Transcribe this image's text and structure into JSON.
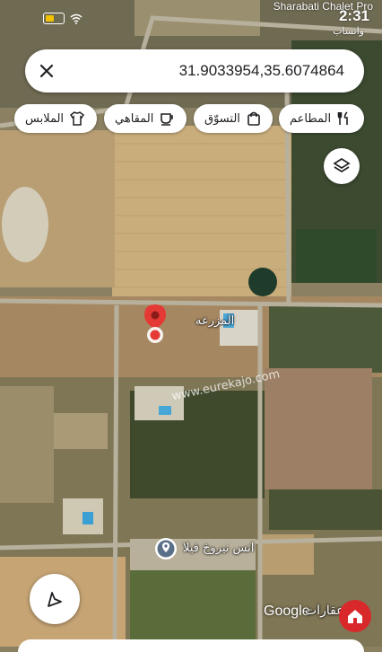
{
  "status_bar": {
    "place": "Sharabati Chalet Pro",
    "time": "2:31",
    "sub": "واتساب"
  },
  "search": {
    "query": "31.9033954,35.6074864"
  },
  "chips": [
    {
      "label": "المطاعم",
      "icon": "restaurant-icon"
    },
    {
      "label": "التسوّق",
      "icon": "shopping-bag-icon"
    },
    {
      "label": "المقاهي",
      "icon": "cafe-icon"
    },
    {
      "label": "الملابس",
      "icon": "shirt-icon"
    }
  ],
  "map": {
    "pin_label": "المزرعه",
    "place_label": "انس نيروخ فيلا",
    "watermark": "www.eurekajo.com"
  },
  "footer": {
    "google_text": "Google",
    "brand_text": "عقارات"
  },
  "colors": {
    "pin": "#e53935",
    "place_marker": "#5a7088",
    "brand": "#d8282a"
  }
}
